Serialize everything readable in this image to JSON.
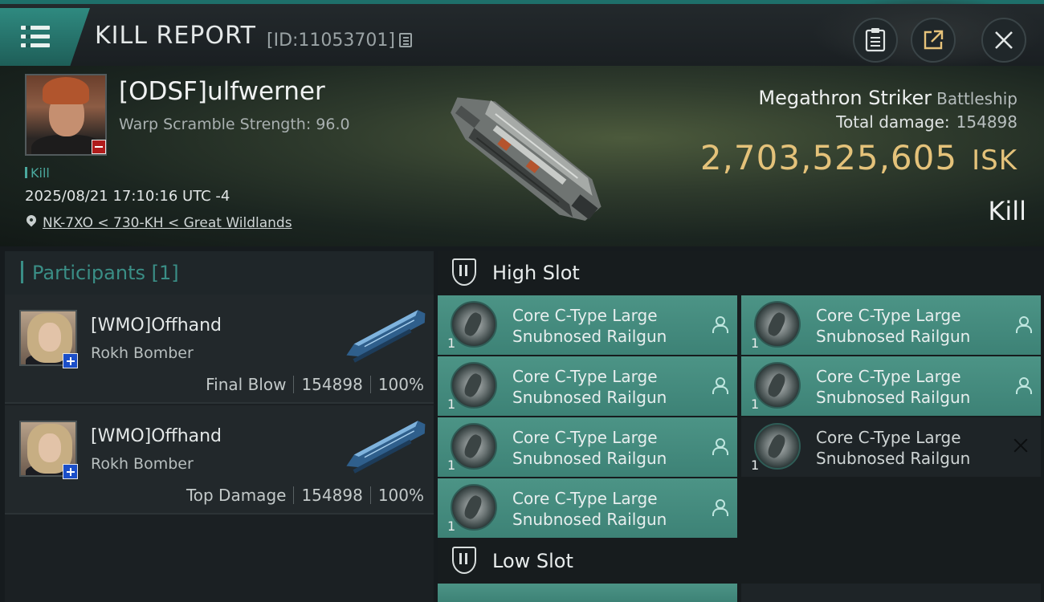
{
  "header": {
    "title": "KILL REPORT",
    "report_id": "[ID:11053701]"
  },
  "victim": {
    "name": "[ODSF]ulfwerner",
    "warp_scramble": "Warp Scramble Strength: 96.0",
    "tag": "Kill",
    "datetime": "2025/08/21 17:10:16 UTC -4",
    "location": "NK-7XO < 730-KH < Great Wildlands",
    "ship_name": "Megathron Striker",
    "ship_class": "Battleship",
    "total_damage_label": "Total damage:",
    "total_damage_value": "154898",
    "isk_value": "2,703,525,605",
    "isk_unit": "ISK",
    "result": "Kill"
  },
  "participants": {
    "title": "Participants [1]",
    "rows": [
      {
        "name": "[WMO]Offhand",
        "ship": "Rokh Bomber",
        "role": "Final Blow",
        "damage": "154898",
        "percent": "100%"
      },
      {
        "name": "[WMO]Offhand",
        "ship": "Rokh Bomber",
        "role": "Top Damage",
        "damage": "154898",
        "percent": "100%"
      }
    ]
  },
  "slots": {
    "high_title": "High Slot",
    "low_title": "Low Slot",
    "high_modules": [
      {
        "qty": "1",
        "line1": "Core C-Type Large",
        "line2": "Snubnosed Railgun",
        "state": "dropped"
      },
      {
        "qty": "1",
        "line1": "Core C-Type Large",
        "line2": "Snubnosed Railgun",
        "state": "dropped"
      },
      {
        "qty": "1",
        "line1": "Core C-Type Large",
        "line2": "Snubnosed Railgun",
        "state": "dropped"
      },
      {
        "qty": "1",
        "line1": "Core C-Type Large",
        "line2": "Snubnosed Railgun",
        "state": "dropped"
      },
      {
        "qty": "1",
        "line1": "Core C-Type Large",
        "line2": "Snubnosed Railgun",
        "state": "dropped"
      },
      {
        "qty": "1",
        "line1": "Core C-Type Large",
        "line2": "Snubnosed Railgun",
        "state": "destroyed"
      },
      {
        "qty": "1",
        "line1": "Core C-Type Large",
        "line2": "Snubnosed Railgun",
        "state": "dropped"
      }
    ]
  },
  "colors": {
    "accent": "#3a8e86",
    "isk_gold": "#e4c27a",
    "module_dropped": "#4c9486",
    "module_destroyed": "#1e2427"
  },
  "icons": {
    "menu": "menu-icon",
    "copy": "copy-icon",
    "clipboard": "clipboard-icon",
    "export": "export-icon",
    "close": "close-icon",
    "pilot": "pilot-icon",
    "location": "location-pin-icon"
  }
}
